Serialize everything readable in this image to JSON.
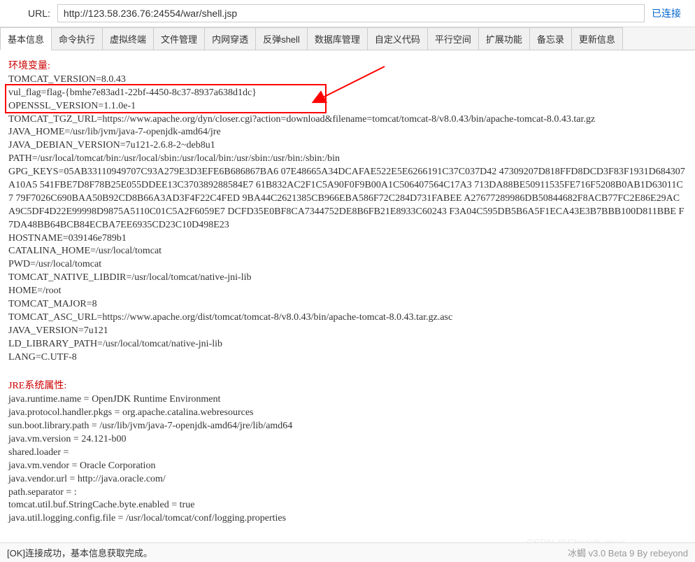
{
  "url_label": "URL:",
  "url_value": "http://123.58.236.76:24554/war/shell.jsp",
  "connection_status": "已连接",
  "tabs": [
    {
      "label": "基本信息",
      "active": true
    },
    {
      "label": "命令执行",
      "active": false
    },
    {
      "label": "虚拟终端",
      "active": false
    },
    {
      "label": "文件管理",
      "active": false
    },
    {
      "label": "内网穿透",
      "active": false
    },
    {
      "label": "反弹shell",
      "active": false
    },
    {
      "label": "数据库管理",
      "active": false
    },
    {
      "label": "自定义代码",
      "active": false
    },
    {
      "label": "平行空间",
      "active": false
    },
    {
      "label": "扩展功能",
      "active": false
    },
    {
      "label": "备忘录",
      "active": false
    },
    {
      "label": "更新信息",
      "active": false
    }
  ],
  "env_section_title": "环境变量:",
  "env_lines": [
    "TOMCAT_VERSION=8.0.43",
    "vul_flag=flag-{bmhe7e83ad1-22bf-4450-8c37-8937a638d1dc}",
    "OPENSSL_VERSION=1.1.0e-1",
    "TOMCAT_TGZ_URL=https://www.apache.org/dyn/closer.cgi?action=download&filename=tomcat/tomcat-8/v8.0.43/bin/apache-tomcat-8.0.43.tar.gz",
    "JAVA_HOME=/usr/lib/jvm/java-7-openjdk-amd64/jre",
    "JAVA_DEBIAN_VERSION=7u121-2.6.8-2~deb8u1",
    "PATH=/usr/local/tomcat/bin:/usr/local/sbin:/usr/local/bin:/usr/sbin:/usr/bin:/sbin:/bin",
    "GPG_KEYS=05AB33110949707C93A279E3D3EFE6B686867BA6 07E48665A34DCAFAE522E5E6266191C37C037D42 47309207D818FFD8DCD3F83F1931D684307A10A5 541FBE7D8F78B25E055DDEE13C370389288584E7 61B832AC2F1C5A90F0F9B00A1C506407564C17A3 713DA88BE50911535FE716F5208B0AB1D63011C7 79F7026C690BAA50B92CD8B66A3AD3F4F22C4FED 9BA44C2621385CB966EBA586F72C284D731FABEE A27677289986DB50844682F8ACB77FC2E86E29AC A9C5DF4D22E99998D9875A5110C01C5A2F6059E7 DCFD35E0BF8CA7344752DE8B6FB21E8933C60243 F3A04C595DB5B6A5F1ECA43E3B7BBB100D811BBE F7DA48BB64BCB84ECBA7EE6935CD23C10D498E23",
    "HOSTNAME=039146e789b1",
    "CATALINA_HOME=/usr/local/tomcat",
    "PWD=/usr/local/tomcat",
    "TOMCAT_NATIVE_LIBDIR=/usr/local/tomcat/native-jni-lib",
    "HOME=/root",
    "TOMCAT_MAJOR=8",
    "TOMCAT_ASC_URL=https://www.apache.org/dist/tomcat/tomcat-8/v8.0.43/bin/apache-tomcat-8.0.43.tar.gz.asc",
    "JAVA_VERSION=7u121",
    "LD_LIBRARY_PATH=/usr/local/tomcat/native-jni-lib",
    "LANG=C.UTF-8"
  ],
  "jre_section_title": "JRE系统属性:",
  "jre_lines": [
    "java.runtime.name = OpenJDK Runtime Environment",
    "java.protocol.handler.pkgs = org.apache.catalina.webresources",
    "sun.boot.library.path = /usr/lib/jvm/java-7-openjdk-amd64/jre/lib/amd64",
    "java.vm.version = 24.121-b00",
    "shared.loader = ",
    "java.vm.vendor = Oracle Corporation",
    "java.vendor.url = http://java.oracle.com/",
    "path.separator = :",
    "tomcat.util.buf.StringCache.byte.enabled = true",
    "java.util.logging.config.file = /usr/local/tomcat/conf/logging.properties"
  ],
  "status_message": "[OK]连接成功，基本信息获取完成。",
  "footer_text": "冰蝎 v3.0 Beta 9   By rebeyond",
  "watermark": "CSDN @Cherish_mari"
}
